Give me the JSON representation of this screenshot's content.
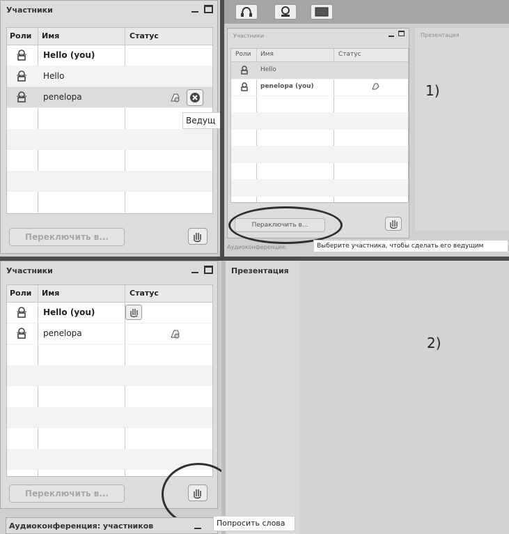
{
  "screenshot1": {
    "participants_panel": {
      "title": "Участники",
      "columns": [
        "Роль",
        "Имя",
        "Статус"
      ],
      "role_col_visible": "Роли",
      "rows": [
        {
          "name": "Hello (you)",
          "bold": true
        },
        {
          "name": "Hello",
          "bold": false
        },
        {
          "name": "penelopa",
          "bold": false
        }
      ],
      "switch_button": "Переключить в...",
      "tooltip": "Ведущ"
    },
    "toolbar": {
      "buttons": [
        "headset-icon",
        "webcam-icon",
        "desktop-share-icon"
      ]
    },
    "inner_participants_panel": {
      "title": "Участники",
      "columns": [
        "Роль",
        "Имя",
        "Статус"
      ],
      "role_col_visible": "Роли",
      "rows": [
        {
          "name": "Hello",
          "bold": false
        },
        {
          "name": "penelopa (you)",
          "bold": true
        }
      ],
      "switch_button": "Пераключить в...",
      "tooltip": "Выберите участника, чтобы сделать его ведущим",
      "audio_label": "Аудиоконференция: "
    },
    "presentation_label": "Презентация",
    "annotation": "1)"
  },
  "screenshot2": {
    "participants_panel": {
      "title": "Участники",
      "columns": [
        "Роль",
        "Имя",
        "Статус"
      ],
      "role_col_visible": "Роли",
      "rows": [
        {
          "name": "Hello (you)",
          "bold": true
        },
        {
          "name": "penelopa",
          "bold": false
        }
      ],
      "switch_button": "Переключить в...",
      "tooltip": "Попросить слова"
    },
    "presentation_label": "Презентация",
    "audio_label": "Аудиоконференция: участников",
    "annotation": "2)"
  },
  "colors": {
    "panel_bg": "#dcdcdc",
    "divider": "#4c4c4c",
    "oval": "#2f2f2f"
  }
}
